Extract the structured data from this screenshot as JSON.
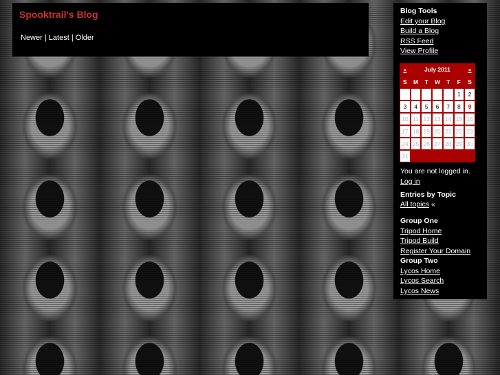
{
  "header": {
    "title": "Spooktrail's Blog",
    "nav": {
      "newer": "Newer",
      "sep1": "|",
      "latest": "Latest",
      "sep2": "|",
      "older": "Older"
    }
  },
  "sidebar": {
    "blog_tools_heading": "Blog Tools",
    "blog_tools": [
      "Edit your Blog",
      "Build a Blog",
      "RSS Feed",
      "View Profile"
    ],
    "calendar": {
      "prev": "«",
      "month": "July 2011",
      "next": "»",
      "day_headers": [
        "S",
        "M",
        "T",
        "W",
        "T",
        "F",
        "S"
      ],
      "weeks": [
        [
          "",
          "",
          "",
          "",
          "",
          "1",
          "2"
        ],
        [
          "3",
          "4",
          "5",
          "6",
          "7",
          "8",
          "9"
        ],
        [
          "10",
          "11",
          "12",
          "13",
          "14",
          "15",
          "16"
        ],
        [
          "17",
          "18",
          "19",
          "20",
          "21",
          "22",
          "23"
        ],
        [
          "24",
          "25",
          "26",
          "27",
          "28",
          "29",
          "30"
        ],
        [
          "31",
          "",
          "",
          "",
          "",
          "",
          ""
        ]
      ],
      "today": "9"
    },
    "login_status": "You are not logged in.",
    "login_link": "Log in",
    "topics_heading": "Entries by Topic",
    "all_topics": "All topics",
    "all_topics_arrow": "«",
    "group_one_heading": "Group One",
    "group_one": [
      "Tripod Home",
      "Tripod Build",
      "Register Your Domain"
    ],
    "group_two_heading": "Group Two",
    "group_two": [
      "Lycos Home",
      "Lycos Search",
      "Lycos News"
    ]
  },
  "colors": {
    "title": "#cc3333",
    "calendar": "#aa0000",
    "panel": "#000000"
  }
}
